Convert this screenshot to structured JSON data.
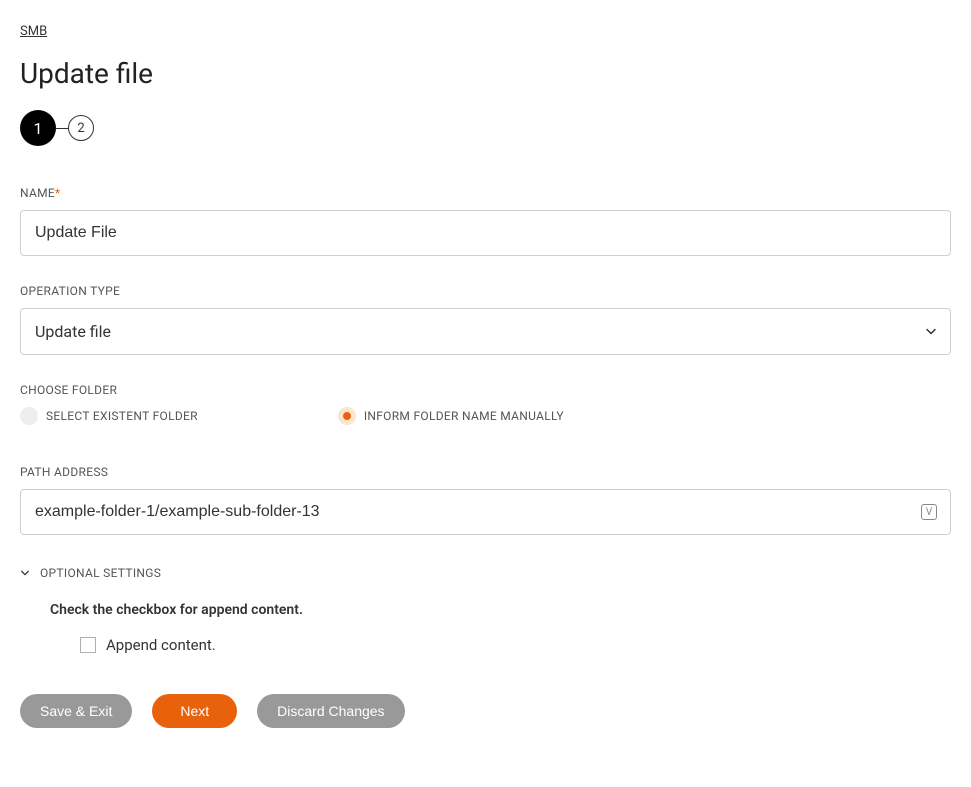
{
  "breadcrumb": "SMB",
  "page_title": "Update file",
  "stepper": {
    "steps": [
      "1",
      "2"
    ],
    "active_index": 0
  },
  "form": {
    "name": {
      "label": "NAME",
      "required": true,
      "value": "Update File"
    },
    "operation_type": {
      "label": "OPERATION TYPE",
      "value": "Update file"
    },
    "choose_folder": {
      "label": "CHOOSE FOLDER",
      "options": [
        {
          "label": "SELECT EXISTENT FOLDER",
          "selected": false
        },
        {
          "label": "INFORM FOLDER NAME MANUALLY",
          "selected": true
        }
      ]
    },
    "path_address": {
      "label": "PATH ADDRESS",
      "value": "example-folder-1/example-sub-folder-13"
    },
    "optional": {
      "toggle_label": "OPTIONAL SETTINGS",
      "hint": "Check the checkbox for append content.",
      "append": {
        "label": "Append content.",
        "checked": false
      }
    }
  },
  "buttons": {
    "save_exit": "Save & Exit",
    "next": "Next",
    "discard": "Discard Changes"
  }
}
